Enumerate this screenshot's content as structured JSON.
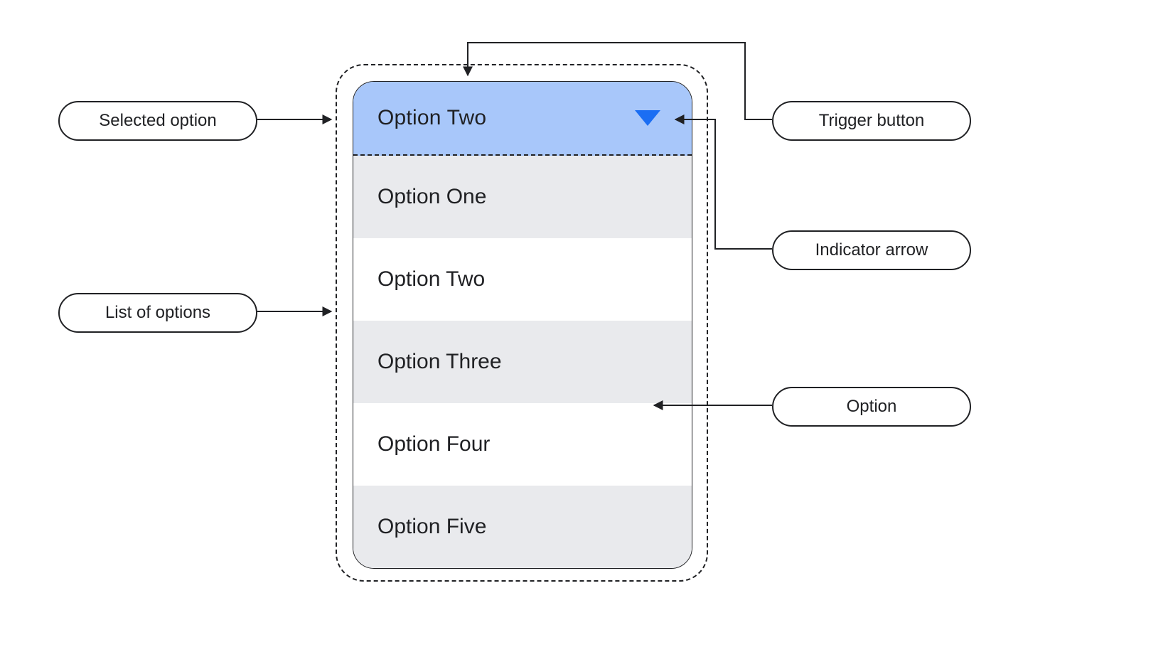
{
  "dropdown": {
    "selected": "Option Two",
    "options": [
      "Option One",
      "Option Two",
      "Option Three",
      "Option  Four",
      "Option Five"
    ]
  },
  "annotations": {
    "selected_option": "Selected option",
    "list_of_options": "List of options",
    "trigger_button": "Trigger button",
    "indicator_arrow": "Indicator arrow",
    "option": "Option"
  },
  "colors": {
    "trigger_bg": "#a8c7fa",
    "option_shade": "#e9eaed",
    "indicator_arrow": "#1b6ef3",
    "stroke": "#202124"
  }
}
